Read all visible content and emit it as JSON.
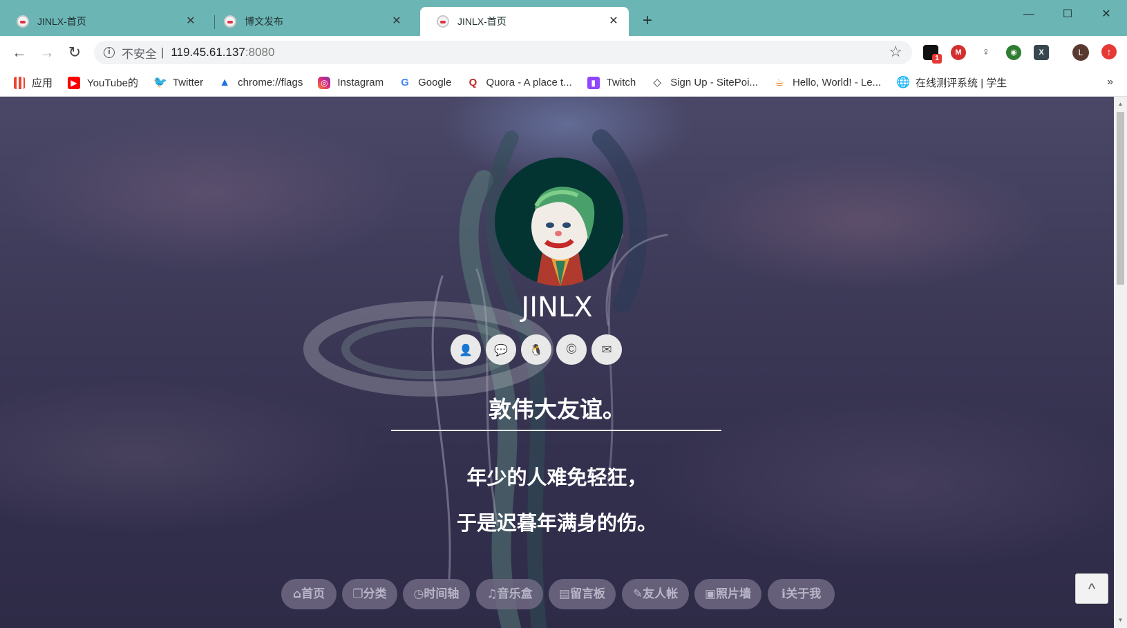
{
  "browser": {
    "tabs": [
      {
        "label": "JINLX-首页",
        "close": "✕"
      },
      {
        "label": "博文发布",
        "close": "✕"
      },
      {
        "label": "JINLX-首页",
        "close": "✕"
      }
    ],
    "new_tab": "+",
    "window_controls": {
      "minimize": "—",
      "maximize": "☐",
      "close": "✕"
    },
    "address": {
      "security": "不安全",
      "separator": "|",
      "host": "119.45.61.137",
      "port": ":8080"
    },
    "profile_initial": "L",
    "extension_badge": "1",
    "bookmarks": [
      {
        "label": "应用",
        "icon": "apps-grid-icon",
        "color": "#4285f4"
      },
      {
        "label": "YouTube的",
        "icon": "youtube-icon",
        "color": "#ff0000"
      },
      {
        "label": "Twitter",
        "icon": "twitter-icon",
        "color": "#1da1f2"
      },
      {
        "label": "chrome://flags",
        "icon": "flask-icon",
        "color": "#1a73e8"
      },
      {
        "label": "Instagram",
        "icon": "instagram-icon",
        "color": "#c13584"
      },
      {
        "label": "Google",
        "icon": "google-icon",
        "color": "#4285f4"
      },
      {
        "label": "Quora - A place t...",
        "icon": "quora-icon",
        "color": "#b92b27"
      },
      {
        "label": "Twitch",
        "icon": "twitch-icon",
        "color": "#9146ff"
      },
      {
        "label": "Sign Up - SitePoi...",
        "icon": "sitepoint-icon",
        "color": "#333333"
      },
      {
        "label": "Hello, World! - Le...",
        "icon": "java-icon",
        "color": "#e76f00"
      },
      {
        "label": "在线测评系统 | 学生",
        "icon": "globe-icon",
        "color": "#555555"
      }
    ],
    "bookmarks_more": "»"
  },
  "page": {
    "site_title": "JINLX",
    "social": [
      {
        "icon": "user-icon",
        "glyph": "👤"
      },
      {
        "icon": "wechat-icon",
        "glyph": "💬"
      },
      {
        "icon": "qq-icon",
        "glyph": "🐧"
      },
      {
        "icon": "copyright-icon",
        "glyph": "©"
      },
      {
        "icon": "envelope-icon",
        "glyph": "✉"
      }
    ],
    "motto": "敦伟大友谊。",
    "poem": [
      "年少的人难免轻狂，",
      "于是迟暮年满身的伤。"
    ],
    "nav": [
      {
        "icon": "home-icon",
        "label": "首页"
      },
      {
        "icon": "copy-icon",
        "label": "分类"
      },
      {
        "icon": "clock-icon",
        "label": "时间轴"
      },
      {
        "icon": "music-icon",
        "label": "音乐盒"
      },
      {
        "icon": "book-icon",
        "label": "留言板"
      },
      {
        "icon": "pencil-icon",
        "label": "友人帐"
      },
      {
        "icon": "image-icon",
        "label": "照片墙"
      },
      {
        "icon": "info-icon",
        "label": "关于我"
      }
    ],
    "back_to_top": "^"
  },
  "colors": {
    "titlebar": "#6cb5b5",
    "page_bg": "#3c3957",
    "nav_pill": "#6e6982",
    "avatar_bg": "#033431"
  }
}
